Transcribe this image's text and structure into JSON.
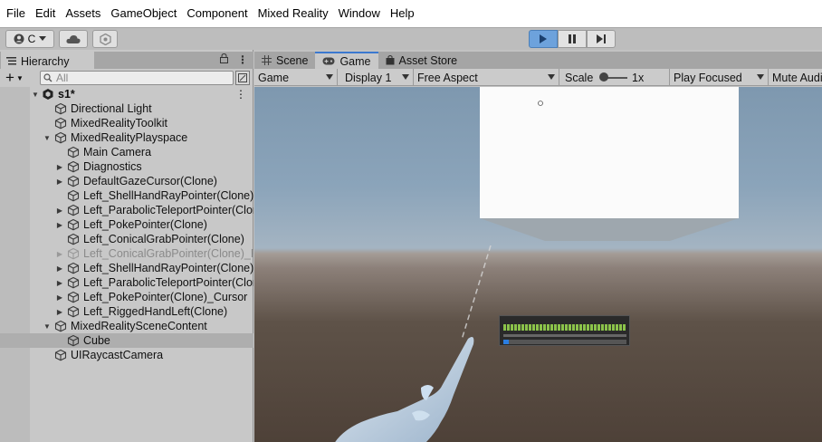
{
  "menu": [
    "File",
    "Edit",
    "Assets",
    "GameObject",
    "Component",
    "Mixed Reality",
    "Window",
    "Help"
  ],
  "toolbar": {
    "account_label": "C"
  },
  "hierarchy": {
    "tab_label": "Hierarchy",
    "search_placeholder": "All",
    "scene_name": "s1*",
    "rows": [
      {
        "label": "Directional Light"
      },
      {
        "label": "MixedRealityToolkit"
      },
      {
        "label": "MixedRealityPlayspace"
      },
      {
        "label": "Main Camera"
      },
      {
        "label": "Diagnostics"
      },
      {
        "label": "DefaultGazeCursor(Clone)"
      },
      {
        "label": "Left_ShellHandRayPointer(Clone)"
      },
      {
        "label": "Left_ParabolicTeleportPointer(Clone)"
      },
      {
        "label": "Left_PokePointer(Clone)"
      },
      {
        "label": "Left_ConicalGrabPointer(Clone)"
      },
      {
        "label": "Left_ConicalGrabPointer(Clone)_Proxy"
      },
      {
        "label": "Left_ShellHandRayPointer(Clone)"
      },
      {
        "label": "Left_ParabolicTeleportPointer(Clone)"
      },
      {
        "label": "Left_PokePointer(Clone)_Cursor"
      },
      {
        "label": "Left_RiggedHandLeft(Clone)"
      },
      {
        "label": "MixedRealitySceneContent"
      },
      {
        "label": "Cube"
      },
      {
        "label": "UIRaycastCamera"
      }
    ]
  },
  "tabs": {
    "scene": "Scene",
    "game": "Game",
    "asset_store": "Asset Store"
  },
  "game_toolbar": {
    "game": "Game",
    "display": "Display 1",
    "aspect": "Free Aspect",
    "scale_label": "Scale",
    "scale_value": "1x",
    "play_mode": "Play Focused",
    "mute": "Mute Audio"
  },
  "colors": {
    "play_active": "#6da2dc",
    "tab_accent": "#3b79d0"
  }
}
